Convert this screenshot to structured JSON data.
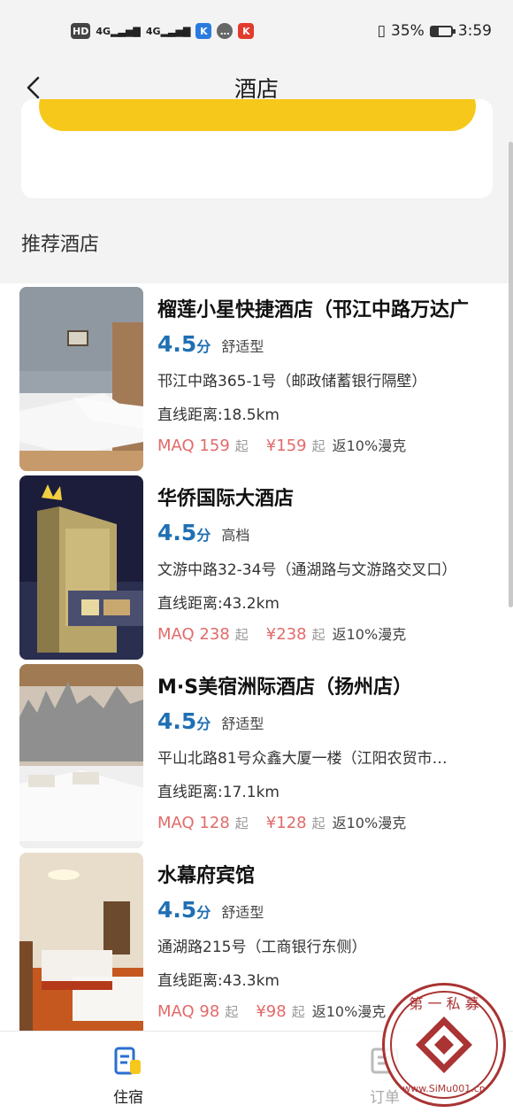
{
  "status_bar": {
    "network_left": "HD",
    "signal1": "4G",
    "signal2": "4G",
    "battery": "35%",
    "battery_level": 0.35,
    "time": "3:59"
  },
  "nav": {
    "title": "酒店",
    "back_icon": "chevron-left-icon"
  },
  "colors": {
    "accent_yellow": "#f7c81c",
    "score_blue": "#1f6fb3",
    "price_red": "#e26a6a",
    "watermark_red": "#aa3333"
  },
  "section_title": "推荐酒店",
  "hotels": [
    {
      "name": "榴莲小星快捷酒店（邗江中路万达广",
      "score": "4.5",
      "score_unit": "分",
      "type": "舒适型",
      "address": "邗江中路365-1号（邮政储蓄银行隔壁）",
      "distance": "直线距离:18.5km",
      "price_maq": "MAQ 159",
      "qi": "起",
      "price_cny": "¥159",
      "cashback": "返10%漫克"
    },
    {
      "name": "华侨国际大酒店",
      "score": "4.5",
      "score_unit": "分",
      "type": "高档",
      "address": "文游中路32-34号（通湖路与文游路交叉口）",
      "distance": "直线距离:43.2km",
      "price_maq": "MAQ 238",
      "qi": "起",
      "price_cny": "¥238",
      "cashback": "返10%漫克"
    },
    {
      "name": "M·S美宿洲际酒店（扬州店）",
      "score": "4.5",
      "score_unit": "分",
      "type": "舒适型",
      "address": "平山北路81号众鑫大厦一楼（江阳农贸市…",
      "distance": "直线距离:17.1km",
      "price_maq": "MAQ 128",
      "qi": "起",
      "price_cny": "¥128",
      "cashback": "返10%漫克"
    },
    {
      "name": "水幕府宾馆",
      "score": "4.5",
      "score_unit": "分",
      "type": "舒适型",
      "address": "通湖路215号（工商银行东侧）",
      "distance": "直线距离:43.3km",
      "price_maq": "MAQ 98",
      "qi": "起",
      "price_cny": "¥98",
      "cashback": "返10%漫克"
    }
  ],
  "tabbar": {
    "tab1_label": "住宿",
    "tab1_icon": "document-icon",
    "tab2_label": "订单",
    "tab2_icon": "order-list-icon"
  },
  "watermark": {
    "line1": "第 一 私 募",
    "line2": "www.SiMu001.cn"
  }
}
